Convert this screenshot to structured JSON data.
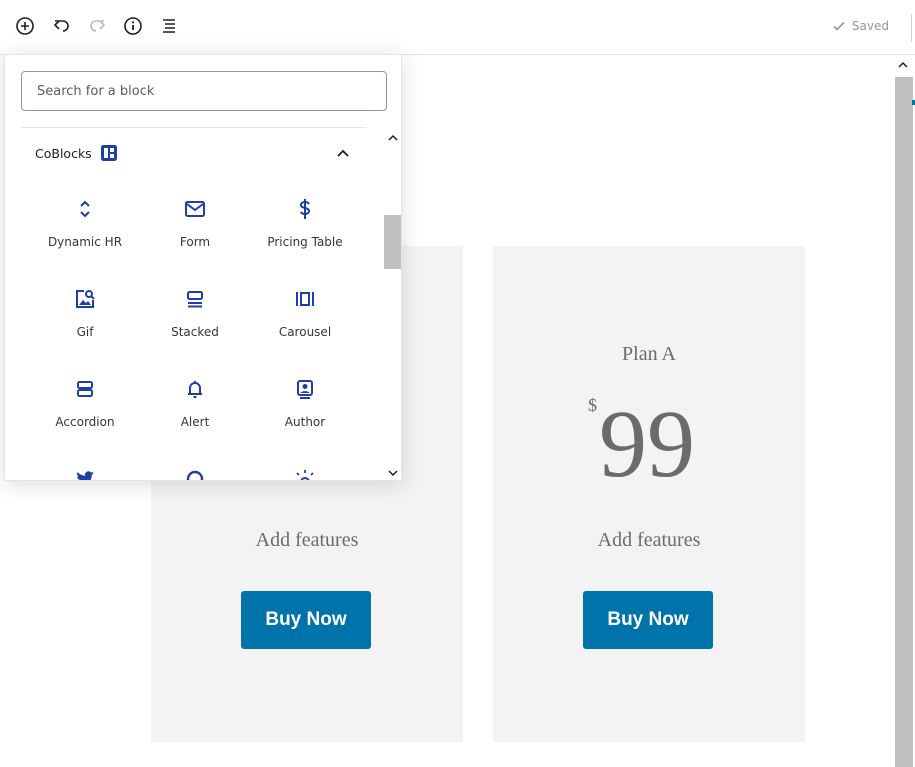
{
  "toolbar": {
    "add_icon": "plus-circle-icon",
    "undo_icon": "undo-icon",
    "redo_icon": "redo-icon",
    "info_icon": "info-icon",
    "outline_icon": "list-icon",
    "saved_label": "Saved"
  },
  "inserter": {
    "search_placeholder": "Search for a block",
    "panel_title": "CoBlocks",
    "blocks": [
      {
        "label": "Dynamic HR",
        "icon": "dynamic-hr-icon"
      },
      {
        "label": "Form",
        "icon": "mail-icon"
      },
      {
        "label": "Pricing Table",
        "icon": "dollar-icon"
      },
      {
        "label": "Gif",
        "icon": "gif-icon"
      },
      {
        "label": "Stacked",
        "icon": "stacked-icon"
      },
      {
        "label": "Carousel",
        "icon": "carousel-icon"
      },
      {
        "label": "Accordion",
        "icon": "accordion-icon"
      },
      {
        "label": "Alert",
        "icon": "bell-icon"
      },
      {
        "label": "Author",
        "icon": "author-icon"
      },
      {
        "label": "",
        "icon": "twitter-icon"
      },
      {
        "label": "",
        "icon": "github-icon"
      },
      {
        "label": "",
        "icon": "lightbulb-icon"
      }
    ]
  },
  "pricing": {
    "cards": [
      {
        "title": "",
        "currency": "",
        "amount": "",
        "features": "Add features",
        "button": "Buy Now"
      },
      {
        "title": "Plan A",
        "currency": "$",
        "amount": "99",
        "features": "Add features",
        "button": "Buy Now"
      }
    ]
  },
  "colors": {
    "accent": "#0073aa",
    "coblocks_blue": "#1e3ea8",
    "card_bg": "#f3f3f3"
  }
}
